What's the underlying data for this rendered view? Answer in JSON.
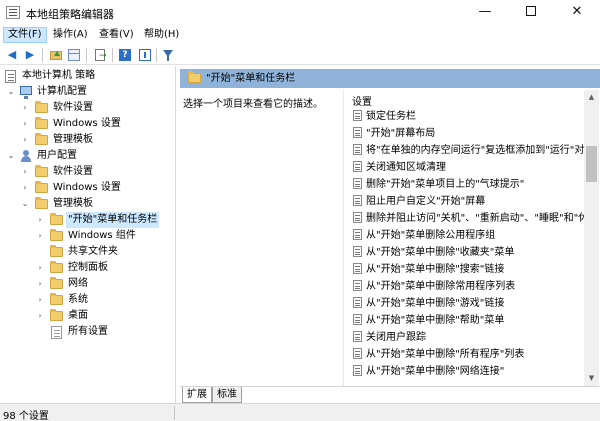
{
  "window": {
    "title": "本地组策略编辑器",
    "min_glyph": "—",
    "close_glyph": "✕"
  },
  "menu": [
    {
      "label": "文件(F)",
      "active": true
    },
    {
      "label": "操作(A)",
      "active": false
    },
    {
      "label": "查看(V)",
      "active": false
    },
    {
      "label": "帮助(H)",
      "active": false
    }
  ],
  "toolbar": {
    "back_glyph": "◀",
    "forward_glyph": "▶",
    "buttons": [
      "back-icon",
      "forward-icon",
      "folder-up-icon",
      "show-hide-tree-icon",
      "export-list-icon",
      "help-icon",
      "properties-icon",
      "filter-icon"
    ]
  },
  "tree": {
    "expanded_glyph": "⌄",
    "collapsed_glyph": "›",
    "items": [
      {
        "label": "本地计算机 策略",
        "icon": "policy-icon"
      },
      {
        "label": "计算机配置",
        "icon": "computer-icon"
      },
      {
        "label": "软件设置",
        "icon": "folder-icon"
      },
      {
        "label": "Windows 设置",
        "icon": "folder-icon"
      },
      {
        "label": "管理模板",
        "icon": "folder-icon"
      },
      {
        "label": "用户配置",
        "icon": "user-icon"
      },
      {
        "label": "软件设置",
        "icon": "folder-icon"
      },
      {
        "label": "Windows 设置",
        "icon": "folder-icon"
      },
      {
        "label": "管理模板",
        "icon": "folder-icon"
      },
      {
        "label": "\"开始\"菜单和任务栏",
        "icon": "folder-icon",
        "selected": true
      },
      {
        "label": "Windows 组件",
        "icon": "folder-icon"
      },
      {
        "label": "共享文件夹",
        "icon": "folder-icon"
      },
      {
        "label": "控制面板",
        "icon": "folder-icon"
      },
      {
        "label": "网络",
        "icon": "folder-icon"
      },
      {
        "label": "系统",
        "icon": "folder-icon"
      },
      {
        "label": "桌面",
        "icon": "folder-icon"
      },
      {
        "label": "所有设置",
        "icon": "document-icon"
      }
    ]
  },
  "right_pane": {
    "header": "\"开始\"菜单和任务栏",
    "description_hint": "选择一个项目来查看它的描述。",
    "settings_column": "设置",
    "settings": [
      "锁定任务栏",
      "\"开始\"屏幕布局",
      "将\"在单独的内存空间运行\"复选框添加到\"运行\"对话框",
      "关闭通知区域清理",
      "删除\"开始\"菜单项目上的\"气球提示\"",
      "阻止用户自定义\"开始\"屏幕",
      "删除并阻止访问\"关机\"、\"重新启动\"、\"睡眠\"和\"休眠\"命令",
      "从\"开始\"菜单删除公用程序组",
      "从\"开始\"菜单中删除\"收藏夹\"菜单",
      "从\"开始\"菜单中删除\"搜索\"链接",
      "从\"开始\"菜单中删除常用程序列表",
      "从\"开始\"菜单中删除\"游戏\"链接",
      "从\"开始\"菜单中删除\"帮助\"菜单",
      "关闭用户跟踪",
      "从\"开始\"菜单中删除\"所有程序\"列表",
      "从\"开始\"菜单中删除\"网络连接\""
    ],
    "scroll_up_glyph": "▲",
    "scroll_down_glyph": "▼",
    "scroll_position": 0.18
  },
  "tabs": [
    {
      "label": "扩展",
      "active": true
    },
    {
      "label": "标准",
      "active": false
    }
  ],
  "status": {
    "text": "98 个设置"
  }
}
